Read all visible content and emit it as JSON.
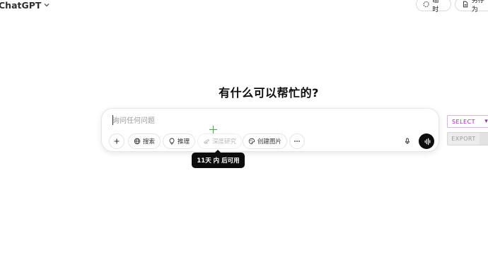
{
  "header": {
    "app_title": "ChatGPT",
    "temporary_label": "临时",
    "save_label": "另存为"
  },
  "main": {
    "greeting": "有什么可以帮忙的?"
  },
  "composer": {
    "placeholder": "询问任何问题",
    "value": "",
    "tools": {
      "search": "搜索",
      "reason": "推理",
      "deep_research": "深度研究",
      "create_image": "创建图片"
    },
    "tooltip": "11天 内 后可用"
  },
  "extension": {
    "select_label": "SELECT",
    "export_label": "EXPORT"
  },
  "icons": [
    "chevron-down-icon",
    "dashed-circle-icon",
    "document-icon",
    "plus-icon",
    "globe-icon",
    "lightbulb-icon",
    "telescope-icon",
    "palette-icon",
    "more-icon",
    "microphone-icon",
    "voice-wave-icon",
    "crosshair-cursor-icon"
  ],
  "colors": {
    "accent_dark": "#0d0d0d",
    "select_purple": "#9c27b0",
    "cursor_green": "#4caf50"
  }
}
